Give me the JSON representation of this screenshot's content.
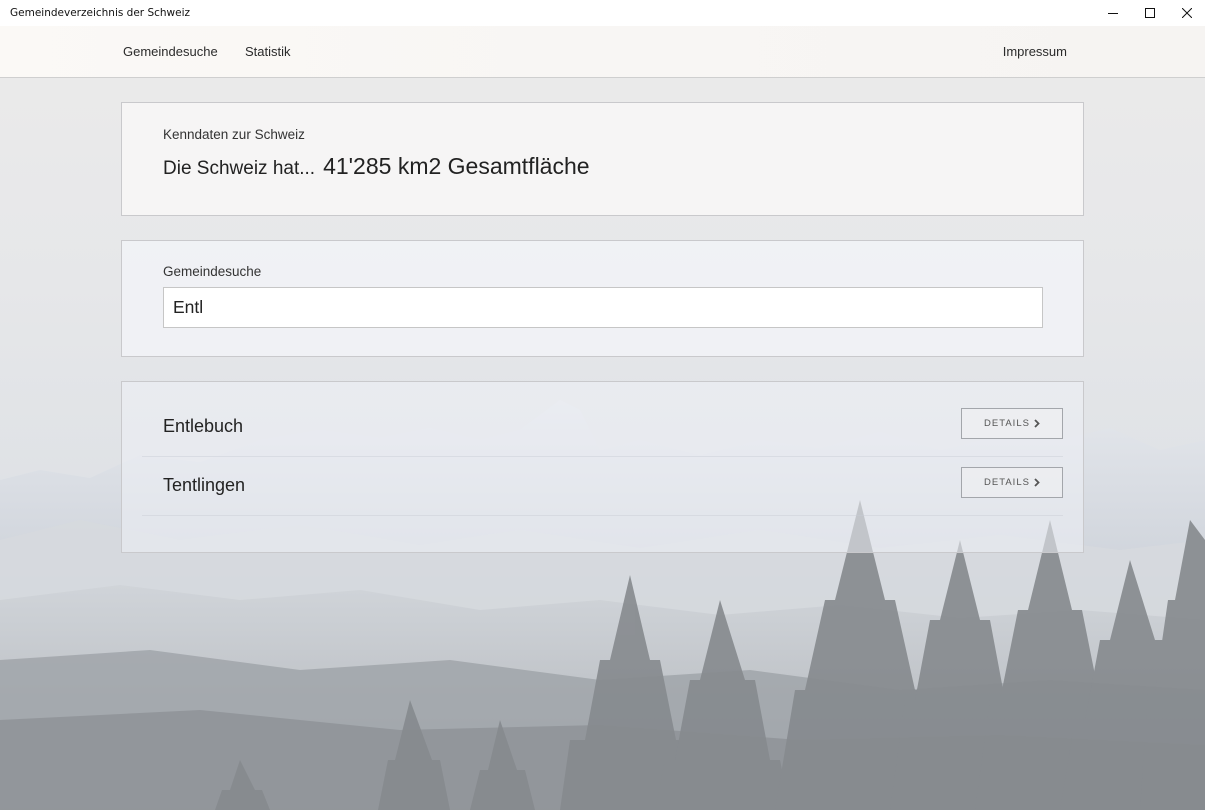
{
  "window": {
    "title": "Gemeindeverzeichnis der Schweiz"
  },
  "nav": {
    "items": [
      {
        "label": "Gemeindesuche"
      },
      {
        "label": "Statistik"
      }
    ],
    "impressum": "Impressum"
  },
  "stats": {
    "caption": "Kenndaten zur Schweiz",
    "prefix": "Die Schweiz hat...",
    "value": "41'285 km2 Gesamtfläche"
  },
  "search": {
    "label": "Gemeindesuche",
    "value": "Entl"
  },
  "results": [
    {
      "name": "Entlebuch",
      "button": "DETAILS"
    },
    {
      "name": "Tentlingen",
      "button": "DETAILS"
    }
  ],
  "icons": {
    "minimize": "minimize-icon",
    "maximize": "maximize-icon",
    "close": "close-icon",
    "details": "chevron-right-icon"
  },
  "colors": {
    "panel_border": "#c9c9cc",
    "text": "#222222",
    "button_border": "#a3a6ab"
  }
}
